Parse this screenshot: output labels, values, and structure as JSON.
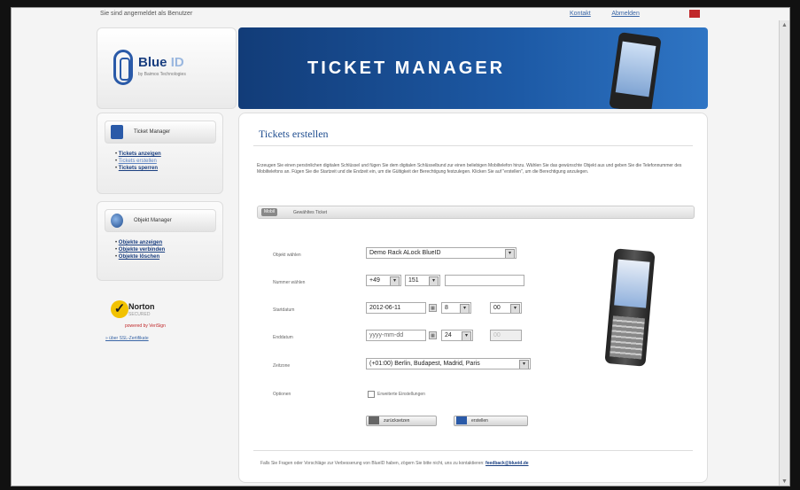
{
  "topbar": {
    "text": "Sie sind angemeldet als Benutzer",
    "links": [
      "Kontakt",
      "Abmelden"
    ]
  },
  "logo": {
    "name": "Blue",
    "name_suffix": "ID",
    "sub": "by Baimos Technologies"
  },
  "banner": {
    "title": "TICKET MANAGER"
  },
  "sidebar": {
    "ticket_manager": {
      "title": "Ticket Manager",
      "items": [
        "Tickets anzeigen",
        "Tickets erstellen",
        "Tickets sperren"
      ]
    },
    "object_manager": {
      "title": "Objekt Manager",
      "items": [
        "Objekte anzeigen",
        "Objekte verbinden",
        "Objekte löschen"
      ]
    }
  },
  "norton": {
    "brand": "Norton",
    "secured": "SECURED",
    "powered": "powered by VeriSign",
    "about": "» über SSL-Zertifikate"
  },
  "main": {
    "title": "Tickets erstellen",
    "intro": "Erzeugen Sie einen persönlichen digitalen Schlüssel und fügen Sie dem digitalen Schlüsselbund zur einen beliebigen Mobiltelefon hinzu. Wählen Sie das gewünschte Objekt aus und geben Sie die Telefonnummer des Mobiltelefons an. Fügen Sie die Startzeit und die Endzeit ein, um die Gültigkeit der Berechtigung festzulegen. Klicken Sie auf \"erstellen\", um die Berechtigung anzulegen.",
    "tab": {
      "key": "Mobil",
      "label": "Gewähltes Ticket"
    },
    "form": {
      "object_label": "Objekt wählen",
      "object_value": "Demo Rack ALock BlueID",
      "number_label": "Nummer wählen",
      "country_code": "+49",
      "area_code": "151",
      "number_value": "",
      "start_label": "Startdatum",
      "start_date": "2012-06-11",
      "start_hour": "8",
      "start_min": "00",
      "end_label": "Enddatum",
      "end_date": "yyyy-mm-dd",
      "end_hour": "24",
      "end_min": "00",
      "tz_label": "Zeitzone",
      "tz_value": "(+01:00) Berlin, Budapest, Madrid, Paris",
      "opt_label": "Optionen",
      "opt_check": "Erweiterte Einstellungen"
    },
    "buttons": {
      "reset": "zurücksetzen",
      "create": "erstellen"
    },
    "footer": "Falls Sie Fragen oder Vorschläge zur Verbesserung von BlueID haben, zögern Sie bitte nicht, uns zu kontaktieren:",
    "footer_link": "feedback@blueid.de"
  }
}
